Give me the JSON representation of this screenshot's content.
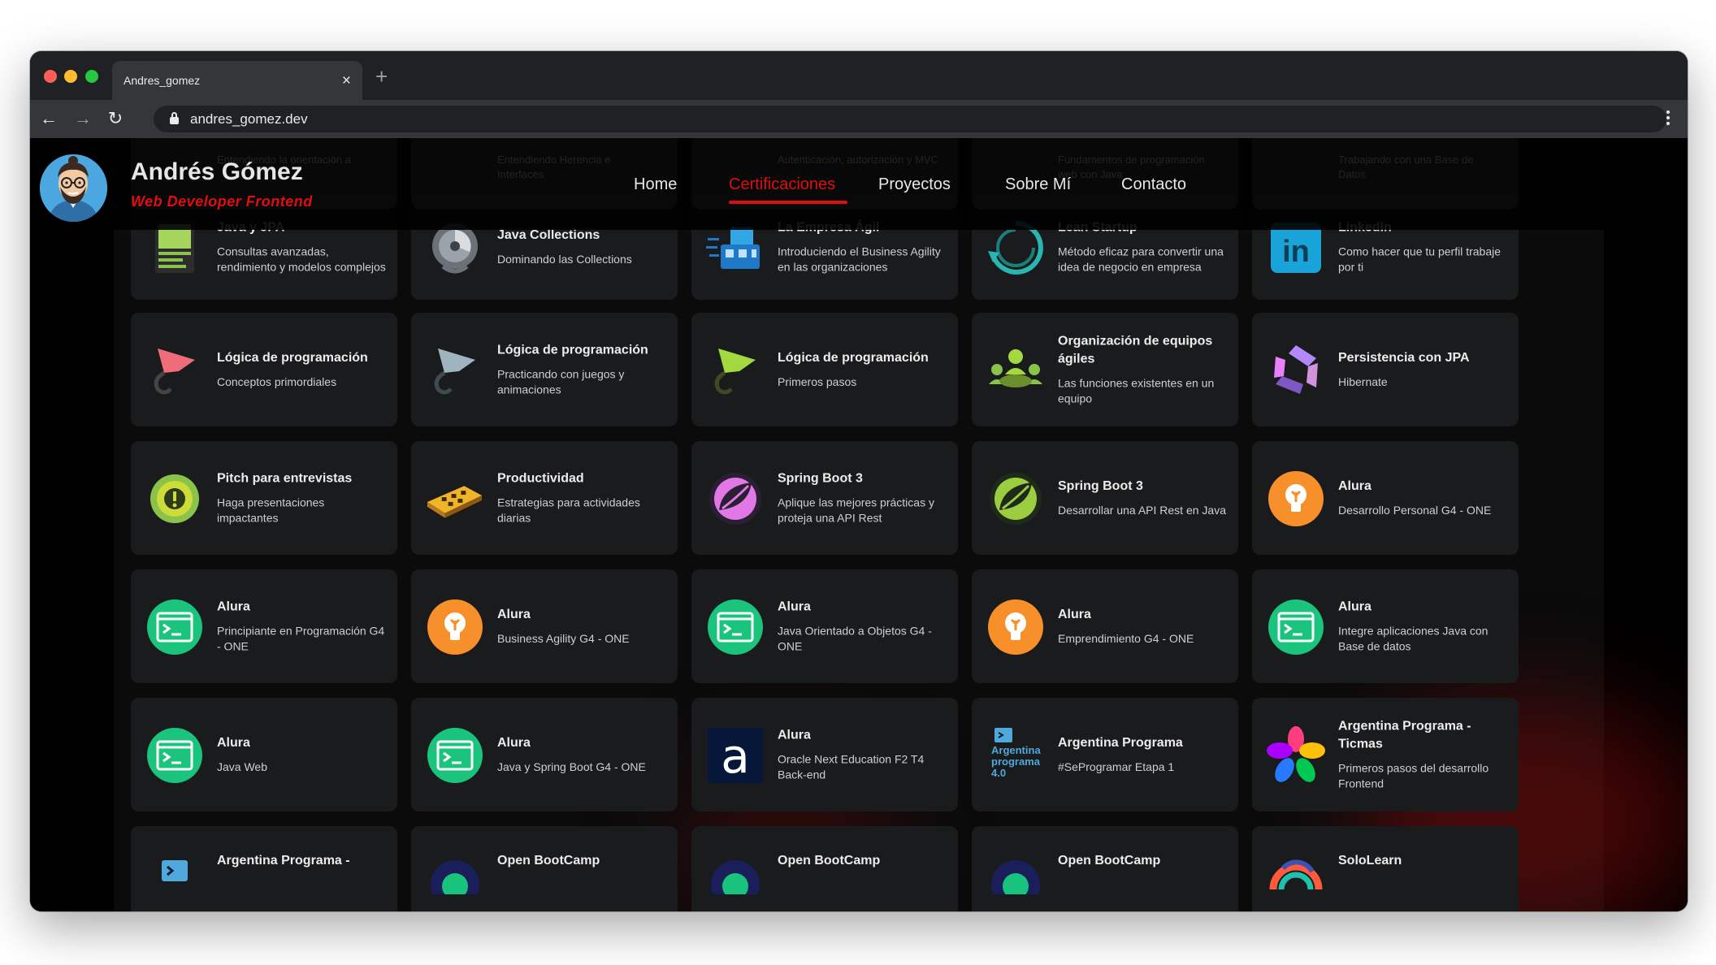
{
  "browser": {
    "tab_title": "Andres_gomez",
    "tab_close": "×",
    "new_tab": "+",
    "back": "←",
    "forward": "→",
    "reload": "↻",
    "url": "andres_gomez.dev"
  },
  "site": {
    "name": "Andrés Gómez",
    "role": "Web Developer Frontend",
    "nav": [
      {
        "label": "Home",
        "active": false
      },
      {
        "label": "Certificaciones",
        "active": true
      },
      {
        "label": "Proyectos",
        "active": false
      },
      {
        "label": "Sobre Mí",
        "active": false
      },
      {
        "label": "Contacto",
        "active": false
      }
    ],
    "scrolled_under_header": [
      "Entendiendo la orientación a",
      "Entendiendo Herencia e Interfaces",
      "Autenticación, autorización y MVC",
      "Fundamentos de programación web con Java",
      "Trabajando con una Base de Datos"
    ]
  },
  "cards": [
    {
      "title": "Java y JPA",
      "desc": "Consultas avanzadas, rendimiento y modelos complejos",
      "icon": "book-icon"
    },
    {
      "title": "Java Collections",
      "desc": "Dominando las Collections",
      "icon": "collections-icon"
    },
    {
      "title": "La Empresa Ágil",
      "desc": "Introduciendo el Business Agility en las organizaciones",
      "icon": "agile-company-icon"
    },
    {
      "title": "Lean Startup",
      "desc": "Método eficaz para convertir una idea de negocio en empresa",
      "icon": "lean-cycle-icon"
    },
    {
      "title": "LinkedIn",
      "desc": "Como hacer que tu perfil trabaje por ti",
      "icon": "linkedin-icon"
    },
    {
      "title": "Lógica de programación",
      "desc": "Conceptos primordiales",
      "icon": "logic-pink-icon"
    },
    {
      "title": "Lógica de programación",
      "desc": "Practicando con juegos y animaciones",
      "icon": "logic-blue-icon"
    },
    {
      "title": "Lógica de programación",
      "desc": "Primeros pasos",
      "icon": "logic-green-icon"
    },
    {
      "title": "Organización de equipos ágiles",
      "desc": "Las funciones existentes en un equipo",
      "icon": "team-icon"
    },
    {
      "title": "Persistencia con JPA",
      "desc": "Hibernate",
      "icon": "persistence-icon"
    },
    {
      "title": "Pitch para entrevistas",
      "desc": "Haga presentaciones impactantes",
      "icon": "pitch-icon"
    },
    {
      "title": "Productividad",
      "desc": "Estrategias para actividades diarias",
      "icon": "productivity-icon"
    },
    {
      "title": "Spring Boot 3",
      "desc": "Aplique las mejores prácticas y proteja una API Rest",
      "icon": "spring-purple-icon"
    },
    {
      "title": "Spring Boot 3",
      "desc": "Desarrollar una API Rest en Java",
      "icon": "spring-green-icon"
    },
    {
      "title": "Alura",
      "desc": "Desarrollo Personal G4 - ONE",
      "icon": "alura-bulb-icon"
    },
    {
      "title": "Alura",
      "desc": "Principiante en Programación G4 - ONE",
      "icon": "alura-terminal-icon"
    },
    {
      "title": "Alura",
      "desc": "Business Agility G4 - ONE",
      "icon": "alura-bulb-icon"
    },
    {
      "title": "Alura",
      "desc": "Java Orientado a Objetos G4 - ONE",
      "icon": "alura-terminal-icon"
    },
    {
      "title": "Alura",
      "desc": "Emprendimiento G4 - ONE",
      "icon": "alura-bulb-icon"
    },
    {
      "title": "Alura",
      "desc": "Integre aplicaciones Java con Base de datos",
      "icon": "alura-terminal-icon"
    },
    {
      "title": "Alura",
      "desc": "Java Web",
      "icon": "alura-terminal-icon"
    },
    {
      "title": "Alura",
      "desc": "Java y Spring Boot G4 - ONE",
      "icon": "alura-terminal-icon"
    },
    {
      "title": "Alura",
      "desc": "Oracle Next Education F2 T4 Back-end",
      "icon": "alura-logo-icon"
    },
    {
      "title": "Argentina Programa",
      "desc": "#SeProgramar Etapa 1",
      "icon": "argentina-programa-icon",
      "icon_text": "Argentina programa 4.0"
    },
    {
      "title": "Argentina Programa - Ticmas",
      "desc": "Primeros pasos del desarrollo Frontend",
      "icon": "ticmas-flower-icon"
    },
    {
      "title": "Argentina Programa -",
      "desc": "",
      "icon": "argentina-terminal-icon"
    },
    {
      "title": "Open BootCamp",
      "desc": "",
      "icon": "openbootcamp-icon"
    },
    {
      "title": "Open BootCamp",
      "desc": "",
      "icon": "openbootcamp-icon"
    },
    {
      "title": "Open BootCamp",
      "desc": "",
      "icon": "openbootcamp-icon"
    },
    {
      "title": "SoloLearn",
      "desc": "",
      "icon": "sololearn-icon"
    }
  ]
}
